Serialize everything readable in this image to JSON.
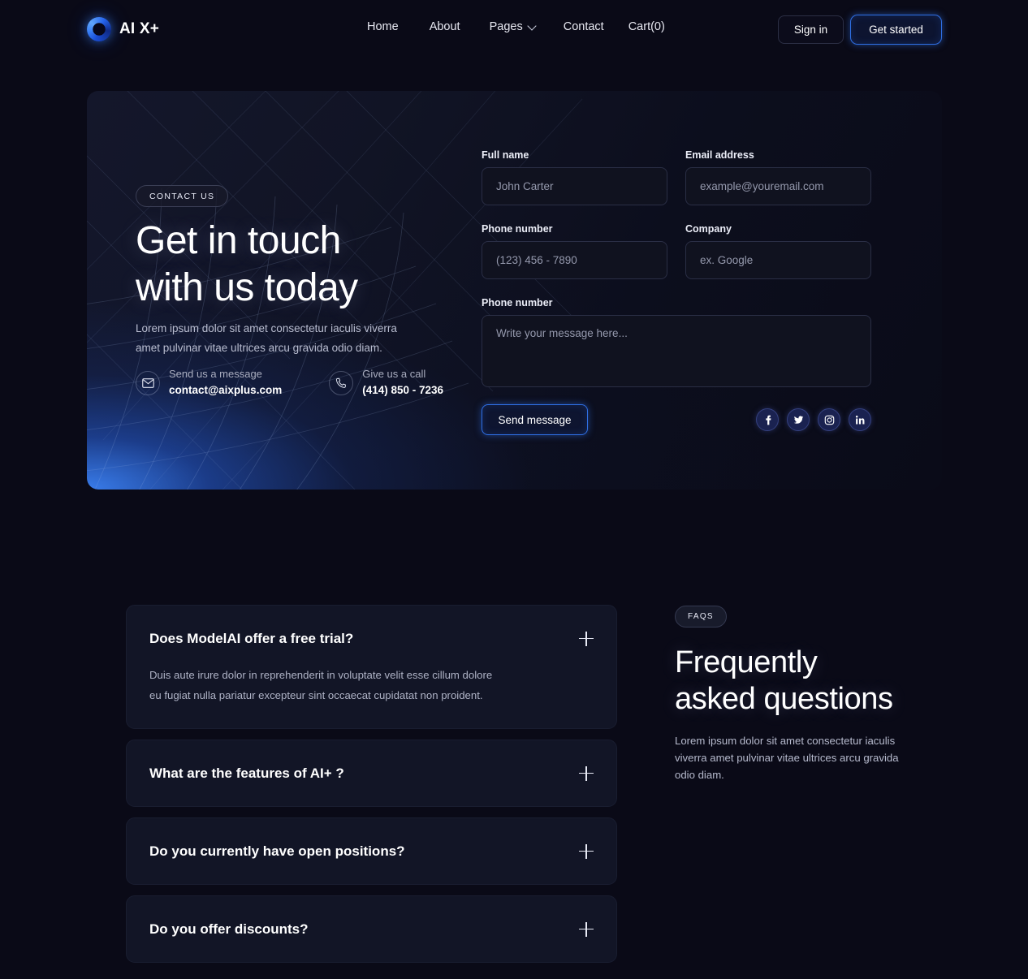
{
  "nav": {
    "logo_text": "AI X+",
    "links": [
      {
        "label": "Home",
        "has_chevron": false
      },
      {
        "label": "About",
        "has_chevron": false
      },
      {
        "label": "Pages",
        "has_chevron": true
      },
      {
        "label": "Contact",
        "has_chevron": false
      },
      {
        "label": "Cart(0)",
        "has_chevron": false
      }
    ],
    "signin_label": "Sign in",
    "getstarted_label": "Get started"
  },
  "contact": {
    "pill": "CONTACT US",
    "headline_line1": "Get in touch",
    "headline_line2": "with us today",
    "subcopy": "Lorem ipsum dolor sit amet consectetur iaculis viverra amet pulvinar vitae ultrices arcu gravida odio diam.",
    "message_label": "Send us a message",
    "message_value": "contact@aixplus.com",
    "call_label": "Give us a call",
    "call_value": "(414) 850 - 7236"
  },
  "form": {
    "fullname_label": "Full name",
    "fullname_placeholder": "John Carter",
    "email_label": "Email address",
    "email_placeholder": "example@youremail.com",
    "phone_label": "Phone number",
    "phone_placeholder": "(123) 456 - 7890",
    "company_label": "Company",
    "company_placeholder": "ex. Google",
    "message_label": "Phone number",
    "message_placeholder": "Write your message here...",
    "send_label": "Send message",
    "socials": [
      "facebook",
      "twitter",
      "instagram",
      "linkedin"
    ]
  },
  "faq": {
    "pill": "FAQS",
    "title_line1": "Frequently",
    "title_line2": "asked questions",
    "subtitle": "Lorem ipsum dolor sit amet consectetur iaculis viverra amet pulvinar vitae ultrices arcu gravida odio diam.",
    "items": [
      {
        "question": "Does ModelAI offer a free trial?",
        "answer": "Duis aute irure dolor in reprehenderit in voluptate velit esse cillum dolore eu fugiat nulla pariatur excepteur sint occaecat cupidatat non proident.",
        "open": true
      },
      {
        "question": "What are the features of AI+ ?",
        "answer": "",
        "open": false
      },
      {
        "question": "Do you currently have open positions?",
        "answer": "",
        "open": false
      },
      {
        "question": "Do you offer discounts?",
        "answer": "",
        "open": false
      }
    ]
  },
  "colors": {
    "page_bg": "#0a0a17",
    "accent_blue": "#2f6fe4",
    "glow_blue": "#3b82f6",
    "card_bg": "#121526",
    "text_primary": "#ffffff",
    "text_muted": "#aeb2c5"
  }
}
